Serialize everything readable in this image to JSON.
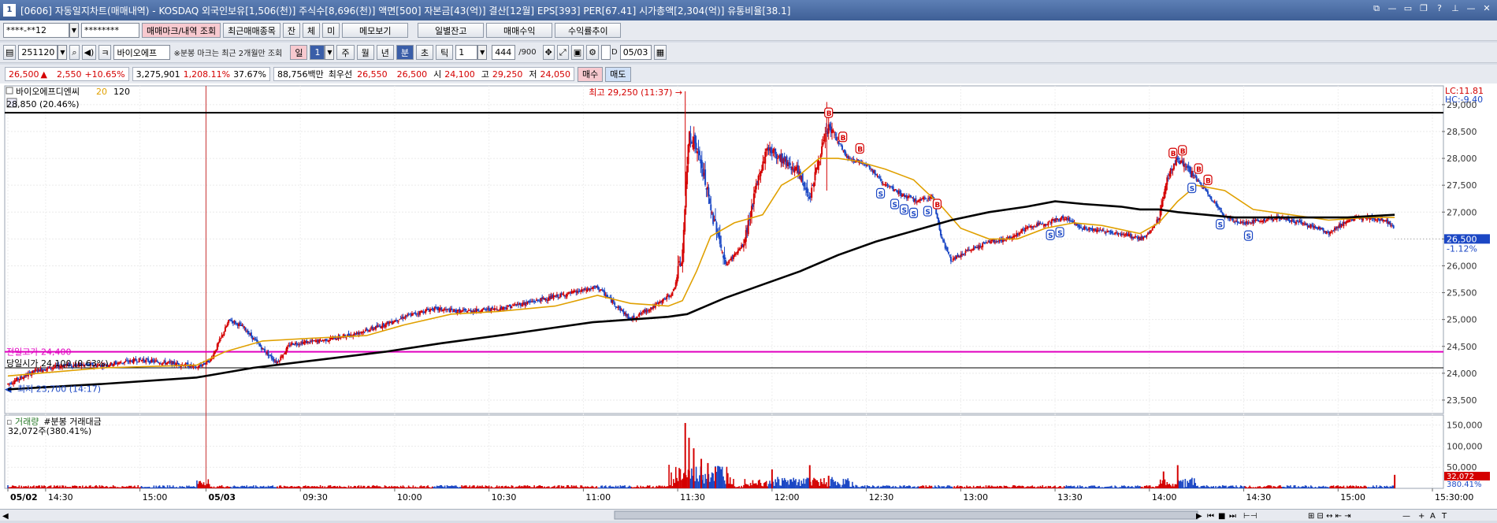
{
  "title": {
    "screen_no": "1",
    "text": "[0606] 자동일지차트(매매내역) - KOSDAQ 외국인보유[1,506(천)] 주식수[8,696(천)] 액면[500] 자본금[43(억)] 결산[12월] EPS[393] PER[67.41] 시가총액[2,304(억)] 유통비율[38.1]",
    "window_buttons": [
      "⧉",
      "—",
      "▭",
      "❐",
      "?",
      "⊥",
      "—",
      "✕"
    ]
  },
  "toolbar1": {
    "account": "****-**12",
    "password": "********",
    "trade_mark_btn": "매매마크/내역 조회",
    "recent_btn": "최근매매종목",
    "tab_jan": "잔",
    "tab_che": "체",
    "tab_mi": "미",
    "memo_btn": "메모보기",
    "daily_btn": "일별잔고",
    "profit_btn": "매매수익",
    "trend_btn": "수익률추이"
  },
  "toolbar2": {
    "code": "251120",
    "stock_name": "바이오에프",
    "note": "※분봉 마크는 최근 2개월만 조회",
    "period_day": "일",
    "period_num": "1",
    "period_week": "주",
    "period_month": "월",
    "period_year": "년",
    "period_min": "분",
    "period_sec": "초",
    "period_tick": "틱",
    "interval": "1",
    "count": "444",
    "count_total": "/900",
    "date_label": "D",
    "date": "05/03"
  },
  "quote": {
    "price": "26,500",
    "change_arrow": "▲",
    "change": "2,550",
    "change_pct": "+10.65%",
    "volume": "3,275,901",
    "volume_ratio": "1,208.11%",
    "turnover": "37.67%",
    "amount": "88,756백만",
    "best_label": "최우선",
    "best_ask": "26,550",
    "best_bid": "26,500",
    "open_label": "시",
    "open": "24,100",
    "high_label": "고",
    "high": "29,250",
    "low_label": "저",
    "low": "24,050",
    "buy_btn": "매수",
    "sell_btn": "매도"
  },
  "chart_data": {
    "type": "candlestick",
    "legend": {
      "name": "바이오에프디엔씨",
      "ma_short": "20",
      "ma_long": "120"
    },
    "ylim": [
      23250,
      29350
    ],
    "yticks": [
      "29,000",
      "28,500",
      "28,000",
      "27,500",
      "27,000",
      "26,500",
      "26,000",
      "25,500",
      "25,000",
      "24,500",
      "24,000",
      "23,500"
    ],
    "x_ticks": [
      {
        "label": "05/02",
        "bold": true,
        "i": 0
      },
      {
        "label": "14:30",
        "i": 40
      },
      {
        "label": "15:00",
        "i": 140
      },
      {
        "label": "05/03",
        "bold": true,
        "i": 210
      },
      {
        "label": "09:30",
        "i": 310
      },
      {
        "label": "10:00",
        "i": 410
      },
      {
        "label": "10:30",
        "i": 510
      },
      {
        "label": "11:00",
        "i": 610
      },
      {
        "label": "11:30",
        "i": 710
      },
      {
        "label": "12:00",
        "i": 810
      },
      {
        "label": "12:30",
        "i": 910
      },
      {
        "label": "13:00",
        "i": 1010
      },
      {
        "label": "13:30",
        "i": 1110
      },
      {
        "label": "14:00",
        "i": 1210
      },
      {
        "label": "14:30",
        "i": 1310
      },
      {
        "label": "15:00",
        "i": 1410
      },
      {
        "label": "15:30:00",
        "i": 1510
      }
    ],
    "x_range": [
      0,
      1520
    ],
    "day_divider_i": 210,
    "price_path": [
      [
        0,
        23800
      ],
      [
        30,
        24050
      ],
      [
        60,
        24150
      ],
      [
        100,
        24150
      ],
      [
        140,
        24250
      ],
      [
        190,
        24150
      ],
      [
        200,
        24100
      ],
      [
        215,
        24250
      ],
      [
        235,
        25000
      ],
      [
        250,
        24850
      ],
      [
        270,
        24450
      ],
      [
        285,
        24200
      ],
      [
        300,
        24550
      ],
      [
        330,
        24600
      ],
      [
        360,
        24700
      ],
      [
        390,
        24850
      ],
      [
        420,
        25050
      ],
      [
        450,
        25200
      ],
      [
        480,
        25150
      ],
      [
        520,
        25200
      ],
      [
        560,
        25350
      ],
      [
        600,
        25500
      ],
      [
        625,
        25600
      ],
      [
        640,
        25350
      ],
      [
        660,
        25000
      ],
      [
        690,
        25300
      ],
      [
        705,
        25500
      ],
      [
        715,
        26200
      ],
      [
        722,
        28500
      ],
      [
        730,
        28200
      ],
      [
        740,
        27500
      ],
      [
        745,
        27000
      ],
      [
        752,
        26700
      ],
      [
        760,
        26000
      ],
      [
        780,
        26400
      ],
      [
        795,
        27600
      ],
      [
        805,
        28200
      ],
      [
        820,
        28000
      ],
      [
        835,
        27800
      ],
      [
        850,
        27300
      ],
      [
        860,
        28000
      ],
      [
        870,
        28600
      ],
      [
        890,
        28000
      ],
      [
        910,
        27900
      ],
      [
        930,
        27500
      ],
      [
        950,
        27300
      ],
      [
        965,
        27200
      ],
      [
        980,
        27300
      ],
      [
        990,
        26500
      ],
      [
        1000,
        26100
      ],
      [
        1020,
        26300
      ],
      [
        1040,
        26450
      ],
      [
        1060,
        26500
      ],
      [
        1080,
        26700
      ],
      [
        1100,
        26800
      ],
      [
        1120,
        26900
      ],
      [
        1140,
        26700
      ],
      [
        1160,
        26650
      ],
      [
        1180,
        26600
      ],
      [
        1200,
        26500
      ],
      [
        1210,
        26600
      ],
      [
        1220,
        26900
      ],
      [
        1230,
        27700
      ],
      [
        1240,
        28000
      ],
      [
        1250,
        27800
      ],
      [
        1260,
        27600
      ],
      [
        1270,
        27400
      ],
      [
        1290,
        26900
      ],
      [
        1310,
        26800
      ],
      [
        1330,
        26850
      ],
      [
        1350,
        26900
      ],
      [
        1370,
        26800
      ],
      [
        1390,
        26700
      ],
      [
        1400,
        26600
      ],
      [
        1420,
        26850
      ],
      [
        1440,
        26900
      ],
      [
        1460,
        26850
      ],
      [
        1470,
        26700
      ]
    ],
    "ma_short": [
      [
        0,
        23950
      ],
      [
        100,
        24100
      ],
      [
        200,
        24150
      ],
      [
        230,
        24400
      ],
      [
        270,
        24600
      ],
      [
        320,
        24650
      ],
      [
        380,
        24700
      ],
      [
        420,
        24900
      ],
      [
        470,
        25100
      ],
      [
        520,
        25150
      ],
      [
        580,
        25250
      ],
      [
        625,
        25450
      ],
      [
        660,
        25300
      ],
      [
        700,
        25250
      ],
      [
        715,
        25350
      ],
      [
        730,
        25900
      ],
      [
        745,
        26550
      ],
      [
        770,
        26800
      ],
      [
        800,
        26950
      ],
      [
        820,
        27500
      ],
      [
        840,
        27700
      ],
      [
        860,
        28000
      ],
      [
        880,
        28000
      ],
      [
        900,
        27950
      ],
      [
        930,
        27800
      ],
      [
        960,
        27600
      ],
      [
        990,
        27100
      ],
      [
        1010,
        26700
      ],
      [
        1040,
        26500
      ],
      [
        1070,
        26500
      ],
      [
        1100,
        26700
      ],
      [
        1130,
        26800
      ],
      [
        1160,
        26750
      ],
      [
        1200,
        26600
      ],
      [
        1220,
        26800
      ],
      [
        1240,
        27200
      ],
      [
        1260,
        27500
      ],
      [
        1290,
        27400
      ],
      [
        1320,
        27050
      ],
      [
        1360,
        26950
      ],
      [
        1400,
        26850
      ],
      [
        1440,
        26900
      ],
      [
        1470,
        26900
      ]
    ],
    "ma_long": [
      [
        0,
        23700
      ],
      [
        100,
        23800
      ],
      [
        200,
        23920
      ],
      [
        260,
        24100
      ],
      [
        330,
        24250
      ],
      [
        400,
        24400
      ],
      [
        460,
        24560
      ],
      [
        520,
        24700
      ],
      [
        580,
        24850
      ],
      [
        620,
        24950
      ],
      [
        660,
        25000
      ],
      [
        700,
        25050
      ],
      [
        720,
        25100
      ],
      [
        760,
        25400
      ],
      [
        800,
        25650
      ],
      [
        840,
        25900
      ],
      [
        880,
        26200
      ],
      [
        920,
        26450
      ],
      [
        960,
        26650
      ],
      [
        1000,
        26850
      ],
      [
        1040,
        27000
      ],
      [
        1080,
        27100
      ],
      [
        1110,
        27200
      ],
      [
        1140,
        27150
      ],
      [
        1180,
        27100
      ],
      [
        1200,
        27050
      ],
      [
        1220,
        27050
      ],
      [
        1240,
        27000
      ],
      [
        1270,
        26950
      ],
      [
        1300,
        26900
      ],
      [
        1340,
        26900
      ],
      [
        1380,
        26900
      ],
      [
        1420,
        26900
      ],
      [
        1470,
        26950
      ]
    ],
    "h_lines": [
      {
        "kind": "high",
        "price": 28850,
        "label": "28,850 (20.46%)",
        "color": "#000000"
      },
      {
        "kind": "prev_high",
        "price": 24400,
        "label": "전일고가 24,400",
        "color": "#e000c0"
      },
      {
        "kind": "today_open",
        "price": 24100,
        "label": "당일시가 24,100 (0.63%)",
        "color": "#000000"
      }
    ],
    "low_label": "최저 23,700 (14:17)",
    "high_annotation": "최고 29,250 (11:37) →",
    "high_annotation_i": 720,
    "markers": [
      {
        "i": 870,
        "t": "B"
      },
      {
        "i": 885,
        "t": "B"
      },
      {
        "i": 903,
        "t": "B"
      },
      {
        "i": 925,
        "t": "S"
      },
      {
        "i": 940,
        "t": "S"
      },
      {
        "i": 950,
        "t": "S"
      },
      {
        "i": 960,
        "t": "S"
      },
      {
        "i": 975,
        "t": "S"
      },
      {
        "i": 985,
        "t": "B"
      },
      {
        "i": 1105,
        "t": "S"
      },
      {
        "i": 1115,
        "t": "S"
      },
      {
        "i": 1235,
        "t": "B"
      },
      {
        "i": 1245,
        "t": "B"
      },
      {
        "i": 1255,
        "t": "S"
      },
      {
        "i": 1262,
        "t": "B"
      },
      {
        "i": 1272,
        "t": "B"
      },
      {
        "i": 1285,
        "t": "S"
      },
      {
        "i": 1315,
        "t": "S"
      }
    ],
    "current_price": "26,500",
    "current_pct": "-1.12%",
    "lc": "LC:11.81",
    "hc": "HC:-9.40",
    "volume_panel": {
      "title_a": "거래량",
      "title_b": "#분봉 거래대금",
      "current": "32,072주(380.41%)",
      "ylim": [
        0,
        170000
      ],
      "yticks": [
        "150,000",
        "100,000",
        "50,000"
      ],
      "last_value": "32,072",
      "last_pct": "380.41%",
      "spikes": [
        [
          718,
          155000
        ],
        [
          722,
          120000
        ],
        [
          727,
          95000
        ],
        [
          735,
          70000
        ],
        [
          742,
          60000
        ],
        [
          750,
          50000
        ],
        [
          810,
          45000
        ],
        [
          850,
          55000
        ],
        [
          870,
          30000
        ],
        [
          1225,
          40000
        ],
        [
          1240,
          55000
        ],
        [
          1470,
          32072
        ]
      ]
    },
    "colors": {
      "up": "#d40000",
      "down": "#1b47c4",
      "ma_short": "#e0a000",
      "ma_long": "#000000"
    }
  }
}
